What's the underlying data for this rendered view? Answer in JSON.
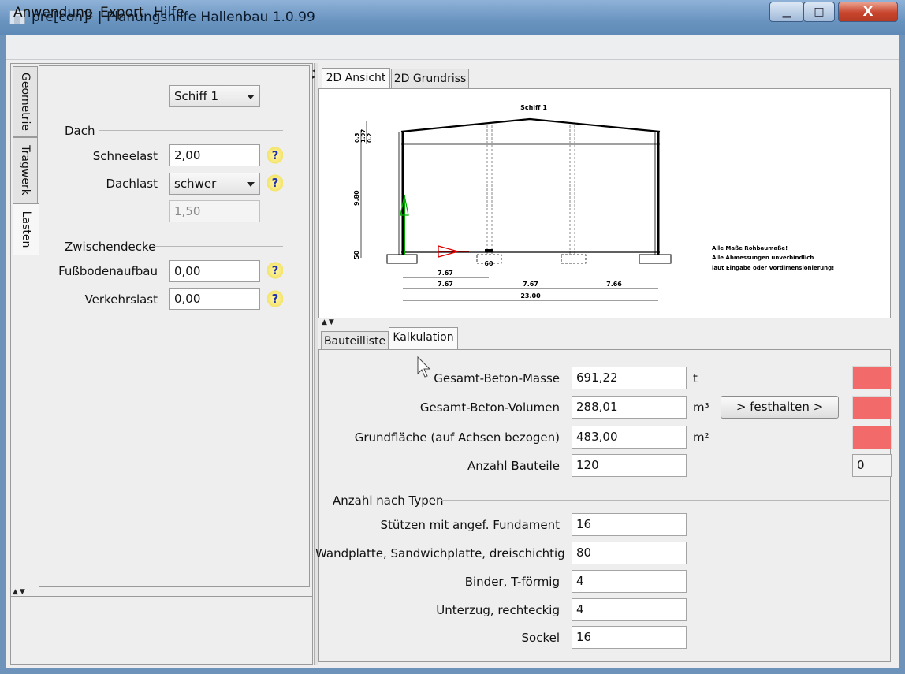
{
  "window": {
    "title": "pre[con]² | Planungshilfe Hallenbau 1.0.99",
    "minimize_symbol": "▁",
    "maximize_symbol": "□",
    "close_symbol": "X"
  },
  "menu": [
    "Anwendung",
    "Export",
    "Hilfe"
  ],
  "left_tabs": [
    "Geometrie",
    "Tragwerk",
    "Lasten"
  ],
  "left": {
    "ship_select": "Schiff 1",
    "dach": {
      "title": "Dach",
      "schneelast_label": "Schneelast",
      "schneelast_value": "2,00",
      "dachlast_label": "Dachlast",
      "dachlast_value": "schwer",
      "dachlast_derived": "1,50"
    },
    "zwischendecke": {
      "title": "Zwischendecke",
      "fussboden_label": "Fußbodenaufbau",
      "fussboden_value": "0,00",
      "verkehrslast_label": "Verkehrslast",
      "verkehrslast_value": "0,00"
    },
    "help_symbol": "?"
  },
  "view_tabs": [
    "2D Ansicht",
    "2D Grundriss"
  ],
  "drawing": {
    "title": "Schiff 1",
    "notes": [
      "Alle Maße Rohbaumaße!",
      "Alle Abmessungen unverbindlich",
      "laut Eingabe oder Vordimensionierung!"
    ],
    "vertical_dims": [
      "0.5",
      "1.97",
      "0.2",
      "9.80",
      "50"
    ],
    "footing_label": "60",
    "horizontal_dims": {
      "row1": [
        "7.67"
      ],
      "row2": [
        "7.67",
        "7.67",
        "7.66"
      ],
      "total": "23.00"
    }
  },
  "bottom_tabs": [
    "Bauteilliste",
    "Kalkulation"
  ],
  "calc": {
    "rows": [
      {
        "label": "Gesamt-Beton-Masse",
        "value": "691,22",
        "unit": "t"
      },
      {
        "label": "Gesamt-Beton-Volumen",
        "value": "288,01",
        "unit": "m³"
      },
      {
        "label": "Grundfläche (auf Achsen bezogen)",
        "value": "483,00",
        "unit": "m²"
      },
      {
        "label": "Anzahl Bauteile",
        "value": "120",
        "unit": ""
      }
    ],
    "festhalten_label": "> festhalten >",
    "side_count": "0",
    "types_title": "Anzahl nach Typen",
    "types": [
      {
        "label": "Stützen mit angef. Fundament",
        "value": "16"
      },
      {
        "label": "Wandplatte, Sandwichplatte, dreischichtig",
        "value": "80"
      },
      {
        "label": "Binder, T-förmig",
        "value": "4"
      },
      {
        "label": "Unterzug, rechteckig",
        "value": "4"
      },
      {
        "label": "Sockel",
        "value": "16"
      }
    ]
  },
  "colors": {
    "highlight_red": "#f26a6a",
    "help_yellow": "#f3e36c"
  }
}
